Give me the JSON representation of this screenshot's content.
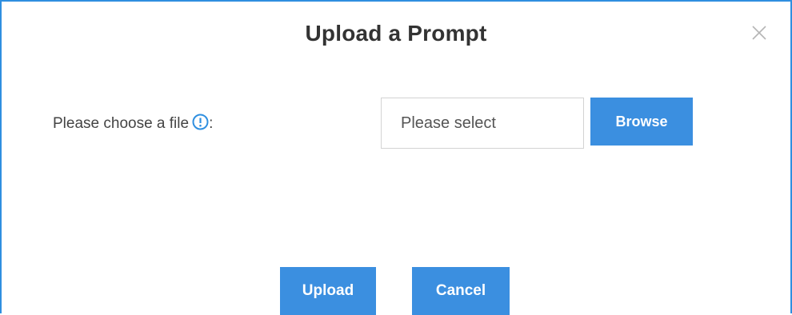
{
  "dialog": {
    "title": "Upload a Prompt",
    "close_icon": "close-icon"
  },
  "file_field": {
    "label": "Please choose a file",
    "label_suffix": ":",
    "info_icon": "info-icon",
    "placeholder": "Please select",
    "value": "",
    "browse_label": "Browse"
  },
  "actions": {
    "upload_label": "Upload",
    "cancel_label": "Cancel"
  },
  "colors": {
    "accent": "#3b8fe0",
    "border": "#2f8fe0",
    "text": "#333333",
    "input_border": "#d3d3d3"
  }
}
